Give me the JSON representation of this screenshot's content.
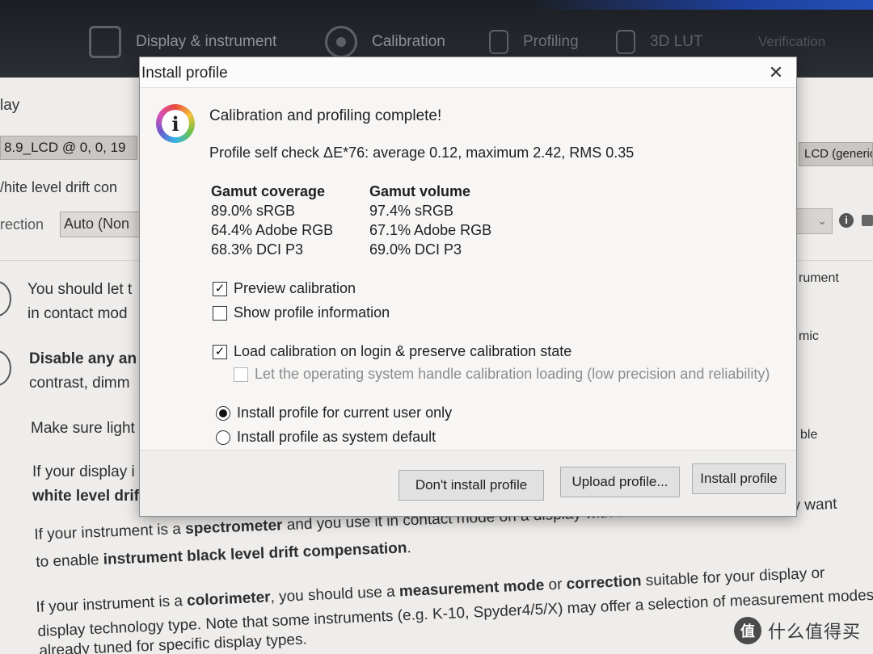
{
  "topbar": {
    "tabs": [
      {
        "label": "Display & instrument",
        "icon": "monitor-icon"
      },
      {
        "label": "Calibration",
        "icon": "target-icon"
      },
      {
        "label": "Profiling",
        "icon": "grid-icon"
      },
      {
        "label": "3D LUT",
        "icon": "lut-icon"
      },
      {
        "label": "Verification",
        "icon": ""
      }
    ]
  },
  "background": {
    "heading": "lay",
    "display_select": "8.9_LCD @ 0, 0, 19",
    "drift_label": "/hite level drift con",
    "correction_label": "rection",
    "correction_value": "Auto (Non",
    "right_select": "LCD (generic",
    "paragraphs": {
      "p1_line1": "You should let t",
      "p1_line2": "in contact mod",
      "p2_line1_bold": "Disable any an",
      "p2_line2": "contrast, dimm",
      "p3": "Make sure light",
      "p4_line1": "If your display i",
      "p4_line2_bold": "white level drif",
      "p5_line1_a": "If your instrument is a ",
      "p5_line1_b": "spectrometer",
      "p5_line1_c": " and you use it in contact mode on a display with stable black level, you may want",
      "p5_line2_a": "to enable ",
      "p5_line2_b": "instrument black level drift compensation",
      "p5_line2_c": ".",
      "p6_line1_a": "If your instrument is a ",
      "p6_line1_b": "colorimeter",
      "p6_line1_c": ", you should use a ",
      "p6_line1_d": "measurement mode",
      "p6_line1_e": " or ",
      "p6_line1_f": "correction",
      "p6_line1_g": " suitable for your display or",
      "p6_line2": "display technology type. Note that some instruments (e.g. K-10, Spyder4/5/X) may offer a selection of measurement modes",
      "p6_line3": "already tuned for specific display types."
    },
    "right_fragments": {
      "r1": "rument",
      "r2": "mic",
      "r3": "ble"
    }
  },
  "dialog": {
    "title": "Install profile",
    "close_glyph": "✕",
    "info_glyph": "i",
    "heading": "Calibration and profiling complete!",
    "self_check": "Profile self check ΔE*76: average 0.12, maximum 2.42, RMS 0.35",
    "gamut_coverage": {
      "header": "Gamut coverage",
      "rows": [
        "89.0% sRGB",
        "64.4% Adobe RGB",
        "68.3% DCI P3"
      ]
    },
    "gamut_volume": {
      "header": "Gamut volume",
      "rows": [
        "97.4% sRGB",
        "67.1% Adobe RGB",
        "69.0% DCI P3"
      ]
    },
    "options": {
      "preview_calibration": {
        "label": "Preview calibration",
        "checked": true
      },
      "show_profile_info": {
        "label": "Show profile information",
        "checked": false
      },
      "load_calibration": {
        "label": "Load calibration on login & preserve calibration state",
        "checked": true
      },
      "os_handle_loading": {
        "label": "Let the operating system handle calibration loading (low precision and reliability)",
        "checked": false,
        "disabled": true
      }
    },
    "install_scope": {
      "selected": "current_user",
      "current_user_label": "Install profile for current user only",
      "system_default_label": "Install profile as system default"
    },
    "buttons": {
      "dont_install": "Don't install profile",
      "upload": "Upload profile...",
      "install": "Install profile"
    },
    "check_glyph": "✓"
  },
  "watermark": {
    "badge": "值",
    "text": "什么值得买"
  }
}
